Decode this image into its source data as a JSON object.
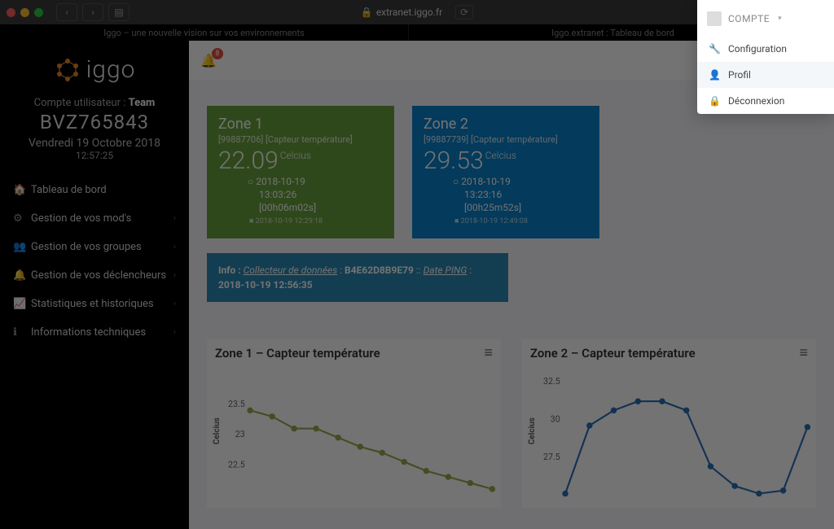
{
  "browser": {
    "address": "extranet.iggo.fr",
    "tabs": [
      "Iggo – une nouvelle vision sur vos environnements",
      "Iggo.extranet : Tableau de bord"
    ]
  },
  "sidebar": {
    "logo_text": "iggo",
    "account_label": "Compte utilisateur : ",
    "account_team": "Team",
    "code": "BVZ765843",
    "date": "Vendredi 19 Octobre 2018",
    "time": "12:57:25",
    "items": [
      {
        "icon": "🏠",
        "label": "Tableau de bord",
        "expandable": false
      },
      {
        "icon": "⚙",
        "label": "Gestion de vos mod's",
        "expandable": true
      },
      {
        "icon": "👥",
        "label": "Gestion de vos groupes",
        "expandable": true
      },
      {
        "icon": "🔔",
        "label": "Gestion de vos déclencheurs",
        "expandable": true
      },
      {
        "icon": "📈",
        "label": "Statistiques et historiques",
        "expandable": true
      },
      {
        "icon": "ℹ",
        "label": "Informations techniques",
        "expandable": true
      }
    ]
  },
  "topbar": {
    "notif_count": "8"
  },
  "zones": [
    {
      "title": "Zone 1",
      "sub": "[99887706] [Capteur température]",
      "value": "22.09",
      "unit": "Celcius",
      "ts1": "2018-10-19 13:03:26",
      "age": "[00h06m02s]",
      "tiny": "2018-10-19 12:29:18"
    },
    {
      "title": "Zone 2",
      "sub": "[99887739] [Capteur température]",
      "value": "29.53",
      "unit": "Celcius",
      "ts1": "2018-10-19 13:23:16",
      "age": "[00h25m52s]",
      "tiny": "2018-10-19 12:49:08"
    }
  ],
  "info": {
    "label": "Info : ",
    "collector": "Collecteur de données",
    "sep": " : ",
    "id": "B4E62D8B9E79",
    "sep2": " :: ",
    "ping_label": "Date PING",
    "sep3": " : ",
    "ping_ts": "2018-10-19 12:56:35"
  },
  "charts": [
    {
      "title": "Zone 1 – Capteur température"
    },
    {
      "title": "Zone 2 – Capteur température"
    }
  ],
  "chart_data": [
    {
      "type": "line",
      "title": "Zone 1 – Capteur température",
      "ylabel": "Celcius",
      "ylim": [
        22.0,
        24.0
      ],
      "yticks": [
        22.5,
        23,
        23.5
      ],
      "series": [
        {
          "name": "Zone 1",
          "color": "#9aa84f",
          "values": [
            23.4,
            23.3,
            23.1,
            23.1,
            22.95,
            22.8,
            22.7,
            22.55,
            22.4,
            22.3,
            22.2,
            22.1
          ]
        }
      ]
    },
    {
      "type": "line",
      "title": "Zone 2 – Capteur température",
      "ylabel": "Celcius",
      "ylim": [
        25,
        33
      ],
      "yticks": [
        27.5,
        30,
        32.5
      ],
      "series": [
        {
          "name": "Zone 2",
          "color": "#2a6fb5",
          "values": [
            25.1,
            29.6,
            30.6,
            31.2,
            31.2,
            30.6,
            26.9,
            25.6,
            25.1,
            25.3,
            29.5
          ]
        }
      ]
    }
  ],
  "dropdown": {
    "header": "COMPTE",
    "items": [
      {
        "icon": "🔧",
        "label": "Configuration"
      },
      {
        "icon": "👤",
        "label": "Profil"
      },
      {
        "icon": "🔒",
        "label": "Déconnexion"
      }
    ]
  }
}
